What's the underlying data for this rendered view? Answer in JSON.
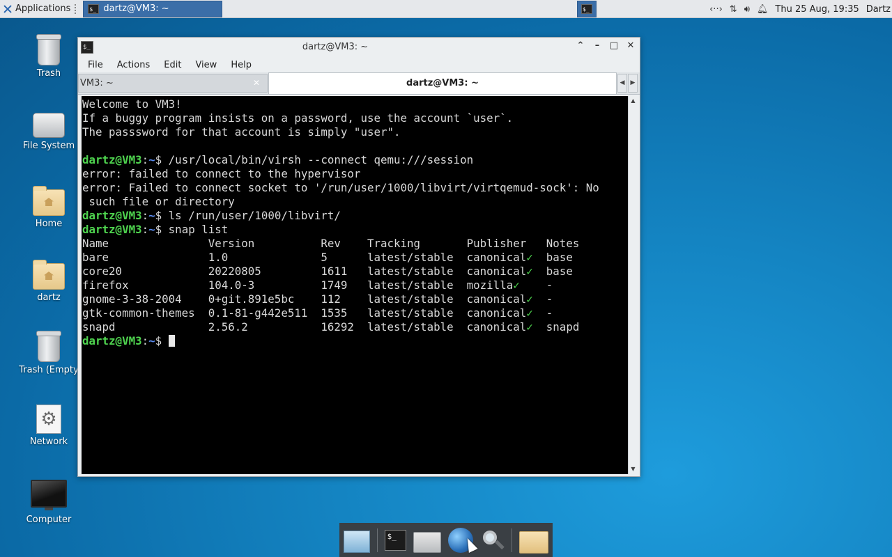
{
  "panel": {
    "applications_label": "Applications",
    "task_label": "dartz@VM3: ~",
    "clock": "Thu 25 Aug, 19:35",
    "user": "Dartz"
  },
  "desktop_icons": [
    {
      "label": "Trash",
      "icon": "trash-icon"
    },
    {
      "label": "File System",
      "icon": "drive-icon"
    },
    {
      "label": "Home",
      "icon": "home-folder-icon"
    },
    {
      "label": "dartz",
      "icon": "home-folder-icon"
    },
    {
      "label": "Trash (Empty",
      "icon": "trash-icon"
    },
    {
      "label": "Network",
      "icon": "gear-icon"
    },
    {
      "label": "Computer",
      "icon": "monitor-icon"
    }
  ],
  "window": {
    "title": "dartz@VM3: ~",
    "menu": [
      "File",
      "Actions",
      "Edit",
      "View",
      "Help"
    ],
    "tabs": [
      {
        "label": "VM3: ~",
        "active": false
      },
      {
        "label": "dartz@VM3: ~",
        "active": true
      }
    ]
  },
  "terminal": {
    "welcome": [
      "Welcome to VM3!",
      "If a buggy program insists on a password, use the account `user`.",
      "The passsword for that account is simply \"user\"."
    ],
    "prompt_user": "dartz@VM3",
    "prompt_path": "~",
    "cmd1": " /usr/local/bin/virsh --connect qemu:///session",
    "err1": "error: failed to connect to the hypervisor",
    "err2a": "error: Failed to connect socket to '/run/user/1000/libvirt/virtqemud-sock': No",
    "err2b": " such file or directory",
    "cmd2": " ls /run/user/1000/libvirt/",
    "cmd3": " snap list",
    "snap_header": [
      "Name",
      "Version",
      "Rev",
      "Tracking",
      "Publisher",
      "Notes"
    ],
    "snap_rows": [
      [
        "bare",
        "1.0",
        "5",
        "latest/stable",
        "canonical",
        "base"
      ],
      [
        "core20",
        "20220805",
        "1611",
        "latest/stable",
        "canonical",
        "base"
      ],
      [
        "firefox",
        "104.0-3",
        "1749",
        "latest/stable",
        "mozilla",
        "-"
      ],
      [
        "gnome-3-38-2004",
        "0+git.891e5bc",
        "112",
        "latest/stable",
        "canonical",
        "-"
      ],
      [
        "gtk-common-themes",
        "0.1-81-g442e511",
        "1535",
        "latest/stable",
        "canonical",
        "-"
      ],
      [
        "snapd",
        "2.56.2",
        "16292",
        "latest/stable",
        "canonical",
        "snapd"
      ]
    ],
    "check_mark": "✓"
  },
  "dock": [
    "show-desktop-icon",
    "terminal-icon",
    "home-icon",
    "web-browser-icon",
    "search-icon",
    "folder-icon"
  ],
  "colors": {
    "prompt_user": "#4fd44f",
    "prompt_path": "#5a8bf0",
    "task_active": "#3b6ea8"
  }
}
